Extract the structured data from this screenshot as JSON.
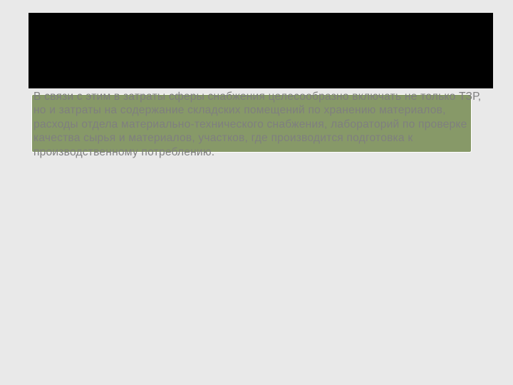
{
  "slide": {
    "body": "В связи с этим в затраты сферы снабжения целесообразно включать не только ТЗР, но и затраты на содержание складских помещений по хранению материалов, расходы отдела материально-технического снабжения, лабораторий по проверке качества сырья и материалов, участков, где производится подготовка к производственному потреблению."
  }
}
